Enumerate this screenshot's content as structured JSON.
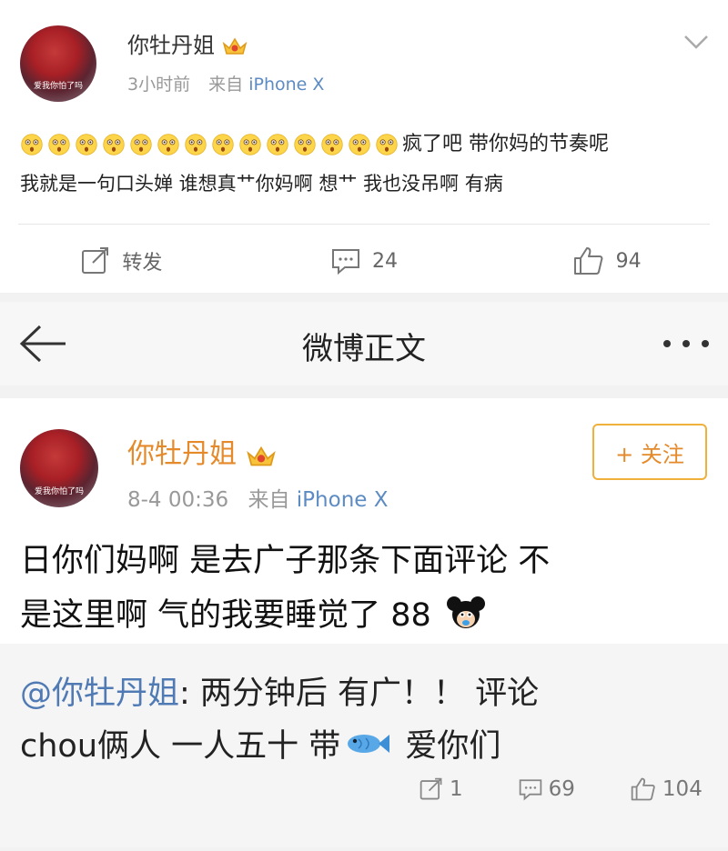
{
  "top_post": {
    "username": "你牡丹姐",
    "avatar_caption": "爱我你怕了吗",
    "time": "3小时前",
    "source_prefix": "来自",
    "source": "iPhone X",
    "text_after_emojis": "疯了吧 带你妈的节奏呢",
    "text_line2": "我就是一句口头婵 谁想真艹你妈啊 想艹 我也没吊啊 有病",
    "emoji_count": 14,
    "repost_label": "转发",
    "comment_count": "24",
    "like_count": "94"
  },
  "navbar": {
    "title": "微博正文"
  },
  "detail_post": {
    "username": "你牡丹姐",
    "avatar_caption": "爱我你怕了吗",
    "time": "8-4 00:36",
    "source_prefix": "来自",
    "source": "iPhone X",
    "follow_label": "+ 关注",
    "text_line1": "日你们妈啊 是去广子那条下面评论 不",
    "text_line2": "是这里啊 气的我要睡觉了 88",
    "repost": {
      "mention": "@你牡丹姐",
      "text_line1": ": 两分钟后 有广！！ 评论",
      "text_line2_before": "chou俩人 一人五十 带",
      "text_line2_after": " 爱你们",
      "repost_count": "1",
      "comment_count": "69",
      "like_count": "104"
    }
  },
  "colors": {
    "orange_name": "#e58a2b",
    "follow_border": "#f0b13b",
    "link_blue": "#4f7ab4"
  }
}
